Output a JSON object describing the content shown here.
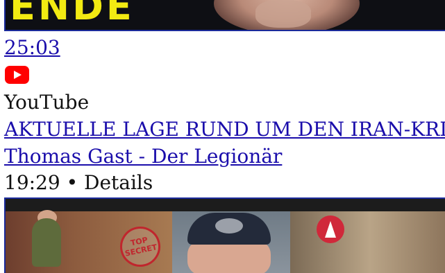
{
  "top_result": {
    "thumbnail_text": "ENDE",
    "duration": "25:03"
  },
  "result": {
    "source_icon": "youtube-icon",
    "source": "YouTube",
    "title": "AKTUELLE LAGE RUND UM DEN IRAN-KRIEG",
    "channel": "Thomas Gast - Der Legionär",
    "meta": "19:29 • Details"
  },
  "bottom_thumbnail": {
    "stamp_text": "TOP SECRET"
  },
  "colors": {
    "link": "#1a0dab",
    "text": "#111111",
    "youtube_red": "#ff0000",
    "thumb_title_yellow": "#f2ea12",
    "thumb_border": "#1a2a9a"
  }
}
